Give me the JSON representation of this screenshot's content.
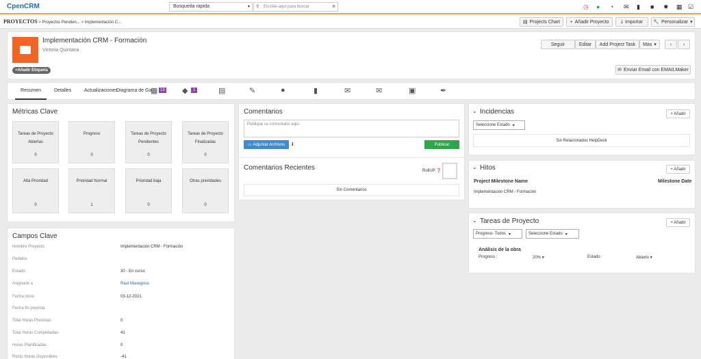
{
  "brand": {
    "name": "CpenCRM"
  },
  "search": {
    "scope": "Busqueda rapida",
    "placeholder": "Escribe aquí para buscar"
  },
  "breadcrumb": {
    "module": "PROYECTOS",
    "items": [
      "Proyectos Pendien...",
      "Implementación C..."
    ]
  },
  "toolbar": {
    "chart": "Projects Chart",
    "add": "Añadir Proyecto",
    "import": "Importar",
    "customize": "Personalizar"
  },
  "record": {
    "title": "Implementación CRM - Formación",
    "owner": "Victoria Quintana",
    "tag_button": "+Añadir Etiqueta"
  },
  "actions": {
    "follow": "Seguir",
    "edit": "Editar",
    "add_task": "Add Project Task",
    "more": "Mas",
    "email": "Enviar Email con EMAILMaker"
  },
  "tabs": {
    "summary": "Resumen",
    "details": "Detalles",
    "updates": "Actualizaciones",
    "gantt": "Diagrama de Ga",
    "badge1": "13",
    "badge2": "1"
  },
  "metrics": {
    "title": "Métricas Clave",
    "items": [
      {
        "label": "Tareas de Proyecto Abiertas",
        "value": "0"
      },
      {
        "label": "Progreso",
        "value": "0"
      },
      {
        "label": "Tareas de Proyecto Pendientes",
        "value": "0"
      },
      {
        "label": "Tareas de Proyecto Finalizadas",
        "value": "0"
      },
      {
        "label": "Alta Prioridad",
        "value": "0"
      },
      {
        "label": "Prioridad Normal",
        "value": "1"
      },
      {
        "label": "Prioridad baja",
        "value": "0"
      },
      {
        "label": "Otras prioridades",
        "value": "0"
      }
    ]
  },
  "fields": {
    "title": "Campos Clave",
    "rows": [
      {
        "k": "Nombre Proyecto",
        "v": "Implementación CRM - Formación"
      },
      {
        "k": "Pedidos",
        "v": ""
      },
      {
        "k": "Estado",
        "v": "30 - En curso"
      },
      {
        "k": "Asignado a",
        "v": "Raul Masegosa"
      },
      {
        "k": "Fecha inicio",
        "v": "03-12-2021"
      },
      {
        "k": "Fecha fin prevista",
        "v": ""
      },
      {
        "k": "Total Horas Previstas",
        "v": "0"
      },
      {
        "k": "Total Horas Completadas",
        "v": "41"
      },
      {
        "k": "Horas Planificadas",
        "v": "0"
      },
      {
        "k": "Resto Horas Disponibles",
        "v": "-41"
      }
    ]
  },
  "comments": {
    "title": "Comentarios",
    "placeholder": "Publique su comentario aquí",
    "attach": "Adjuntar Archivos",
    "publish": "Publicar",
    "recent_title": "Comentarios Recientes",
    "rollup": "RollUP",
    "empty": "Sin Comentarios"
  },
  "incidents": {
    "title": "Incidencias",
    "add": "+ Añadir",
    "select": "Seleccione Estado",
    "empty": "Sin Relacionados HelpDesk"
  },
  "milestones": {
    "title": "Hitos",
    "add": "+ Añadir",
    "col1": "Project Milestone Name",
    "col2": "Milestone Date",
    "row": "Implementacion CRM - Formación"
  },
  "tasks": {
    "title": "Tareas de Proyecto",
    "add": "+ Añadir",
    "filter_progress": "Progreso- Todos",
    "filter_status": "Seleccione Estado",
    "task_name": "Análisis de la obra",
    "progress_label": "Progress :",
    "progress_value": "20%",
    "status_label": "Estado :",
    "status_value": "Abierto"
  },
  "colors": {
    "accent": "#f26522",
    "green": "#2ba84a",
    "blue": "#428bca",
    "purple": "#8e44ad"
  }
}
